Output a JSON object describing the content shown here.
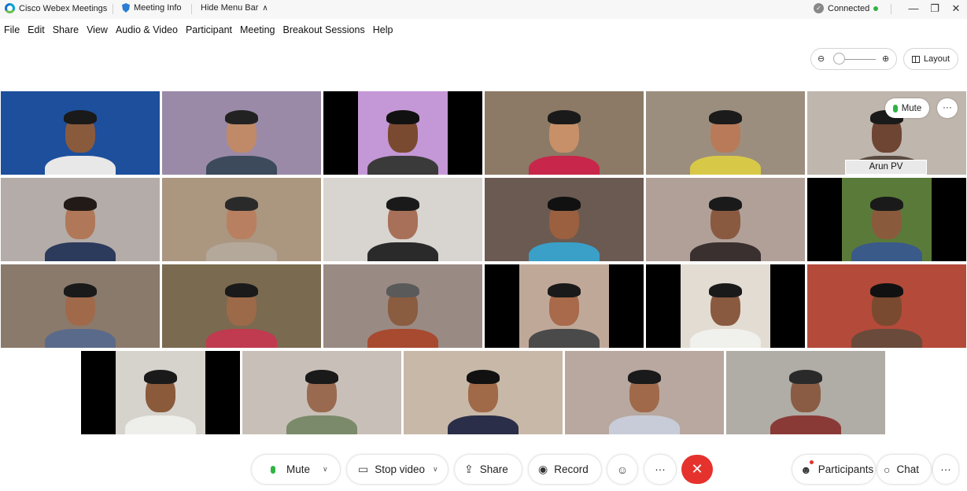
{
  "titlebar": {
    "app_name": "Cisco Webex Meetings",
    "meeting_info": "Meeting Info",
    "hide_menu_bar": "Hide Menu Bar",
    "connection_status": "Connected",
    "status_color": "#2fb344"
  },
  "window_controls": {
    "minimize": "—",
    "restore": "❐",
    "close": "✕"
  },
  "menu": [
    "File",
    "Edit",
    "Share",
    "View",
    "Audio & Video",
    "Participant",
    "Meeting",
    "Breakout Sessions",
    "Help"
  ],
  "view_controls": {
    "zoom_out": "⊖",
    "zoom_in": "⊕",
    "layout_label": "Layout"
  },
  "video_tiles": [
    {
      "bg": "#1d4f9c",
      "skin": "#8a5a3c",
      "shirt": "#e8e8e8",
      "hair": "#1a1a1a"
    },
    {
      "bg": "#9a8aa8",
      "skin": "#c08a68",
      "shirt": "#3c4a5c",
      "hair": "#222"
    },
    {
      "bg": "#c497d6",
      "skin": "#7a4a30",
      "shirt": "#3a3a3a",
      "hair": "#111",
      "bars": true
    },
    {
      "bg": "#8c7a66",
      "skin": "#c79068",
      "shirt": "#c8264a",
      "hair": "#1a1a1a"
    },
    {
      "bg": "#9c8e7e",
      "skin": "#b87a58",
      "shirt": "#d8c848",
      "hair": "#1b1b1b"
    },
    {
      "bg": "#bfb6ae",
      "skin": "#6e4432",
      "shirt": "#5a4a40",
      "hair": "#1a1a1a"
    },
    {
      "bg": "#b4aca8",
      "skin": "#b07858",
      "shirt": "#2c3a5c",
      "hair": "#221a16"
    },
    {
      "bg": "#ab9680",
      "skin": "#b88060",
      "shirt": "#b4a89a",
      "hair": "#2a2a2a"
    },
    {
      "bg": "#d8d4d0",
      "skin": "#a87058",
      "shirt": "#2a2a2a",
      "hair": "#1a1a1a"
    },
    {
      "bg": "#6a5a52",
      "skin": "#9a6040",
      "shirt": "#3aa0c8",
      "hair": "#111"
    },
    {
      "bg": "#b0a098",
      "skin": "#8a5a40",
      "shirt": "#3a3030",
      "hair": "#1a1a1a"
    },
    {
      "bg": "#5a7a3a",
      "skin": "#8a5a3c",
      "shirt": "#3a5a8a",
      "hair": "#1a1a1a",
      "bars": true
    },
    {
      "bg": "#8a7a6c",
      "skin": "#a06a4a",
      "shirt": "#5a6a8a",
      "hair": "#1a1a1a"
    },
    {
      "bg": "#7a6a50",
      "skin": "#9c6a48",
      "shirt": "#c03a50",
      "hair": "#1a1a1a"
    },
    {
      "bg": "#9a8a84",
      "skin": "#8a5c40",
      "shirt": "#a84a30",
      "hair": "#5a5a5a"
    },
    {
      "bg": "#c0a898",
      "skin": "#a86a4a",
      "shirt": "#4a4a4a",
      "hair": "#1a1a1a",
      "bars": true
    },
    {
      "bg": "#e2dcd2",
      "skin": "#8a5a40",
      "shirt": "#f0f0ec",
      "hair": "#1a1a1a",
      "bars": true
    },
    {
      "bg": "#b44a3a",
      "skin": "#7a4a30",
      "shirt": "#6a4a3a",
      "hair": "#111"
    },
    {
      "bg": "#d6d2cc",
      "skin": "#8a5a3a",
      "shirt": "#eeeeea",
      "hair": "#1a1a1a",
      "bars": true
    },
    {
      "bg": "#c8c0b8",
      "skin": "#9a6a50",
      "shirt": "#7a8a6a",
      "hair": "#1a1a1a"
    },
    {
      "bg": "#c8b8a8",
      "skin": "#a06a48",
      "shirt": "#2a2e48",
      "hair": "#111"
    },
    {
      "bg": "#b8a8a0",
      "skin": "#a06a4a",
      "shirt": "#c8ccd8",
      "hair": "#1a1a1a"
    },
    {
      "bg": "#b0aca6",
      "skin": "#8a5c44",
      "shirt": "#8a3a36",
      "hair": "#2a2a2a"
    }
  ],
  "active_tile": {
    "name": "Arun PV",
    "mute_label": "Mute",
    "more_label": "···"
  },
  "toolbar": {
    "mute": "Mute",
    "stop_video": "Stop video",
    "share": "Share",
    "record": "Record",
    "more": "···",
    "end": "✕",
    "participants": "Participants",
    "chat": "Chat",
    "panel_more": "···",
    "end_color": "#e6322d",
    "mic_color": "#2fb344"
  }
}
